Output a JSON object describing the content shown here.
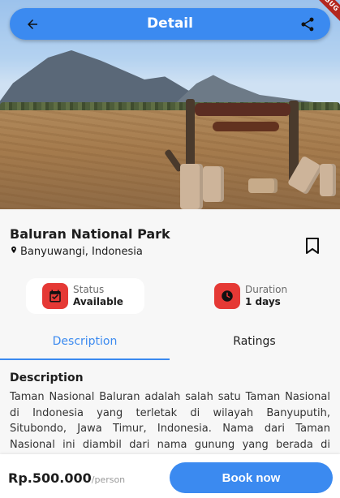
{
  "appbar": {
    "title": "Detail",
    "back_icon": "arrow-back-icon",
    "share_icon": "share-icon",
    "accent": "#3b8af0"
  },
  "debug_banner": "DEBUG",
  "place": {
    "name": "Baluran National Park",
    "location": "Banyuwangi, Indonesia",
    "location_icon": "location-pin-icon",
    "bookmark_icon": "bookmark-icon"
  },
  "info": {
    "status": {
      "label": "Status",
      "value": "Available",
      "icon": "calendar-check-icon"
    },
    "duration": {
      "label": "Duration",
      "value": "1 days",
      "icon": "clock-icon"
    },
    "icon_color": "#e53935"
  },
  "tabs": [
    {
      "label": "Description",
      "active": true
    },
    {
      "label": "Ratings",
      "active": false
    }
  ],
  "description": {
    "heading": "Description",
    "body": "Taman Nasional Baluran adalah salah satu Taman Nasional di Indonesia yang terletak di wilayah Banyuputih, Situbondo, Jawa Timur, Indonesia. Nama dari Taman Nasional ini diambil dari nama gunung yang berada di daerah ini, yaitu gunung Baluran."
  },
  "booking": {
    "price": "Rp.500.000",
    "unit": "/person",
    "button_label": "Book now"
  }
}
